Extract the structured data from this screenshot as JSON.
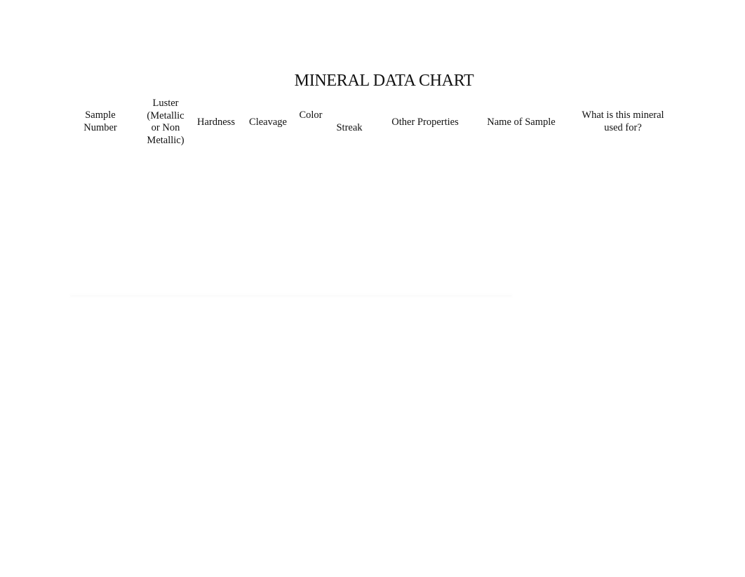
{
  "document": {
    "title": "MINERAL DATA CHART",
    "columns": [
      {
        "key": "sample_number",
        "lines": [
          "Sample",
          "Number"
        ]
      },
      {
        "key": "luster",
        "lines": [
          "Luster",
          "(Metallic",
          "or Non",
          "Metallic)"
        ]
      },
      {
        "key": "hardness",
        "lines": [
          "Hardness"
        ]
      },
      {
        "key": "cleavage",
        "lines": [
          "Cleavage"
        ]
      },
      {
        "key": "color",
        "lines": [
          "Color"
        ]
      },
      {
        "key": "streak",
        "lines": [
          "Streak"
        ]
      },
      {
        "key": "other_properties",
        "lines": [
          "Other Properties"
        ]
      },
      {
        "key": "name_of_sample",
        "lines": [
          "Name of Sample"
        ]
      },
      {
        "key": "use",
        "lines": [
          "What is this mineral",
          "used for?"
        ]
      }
    ],
    "rows": []
  }
}
